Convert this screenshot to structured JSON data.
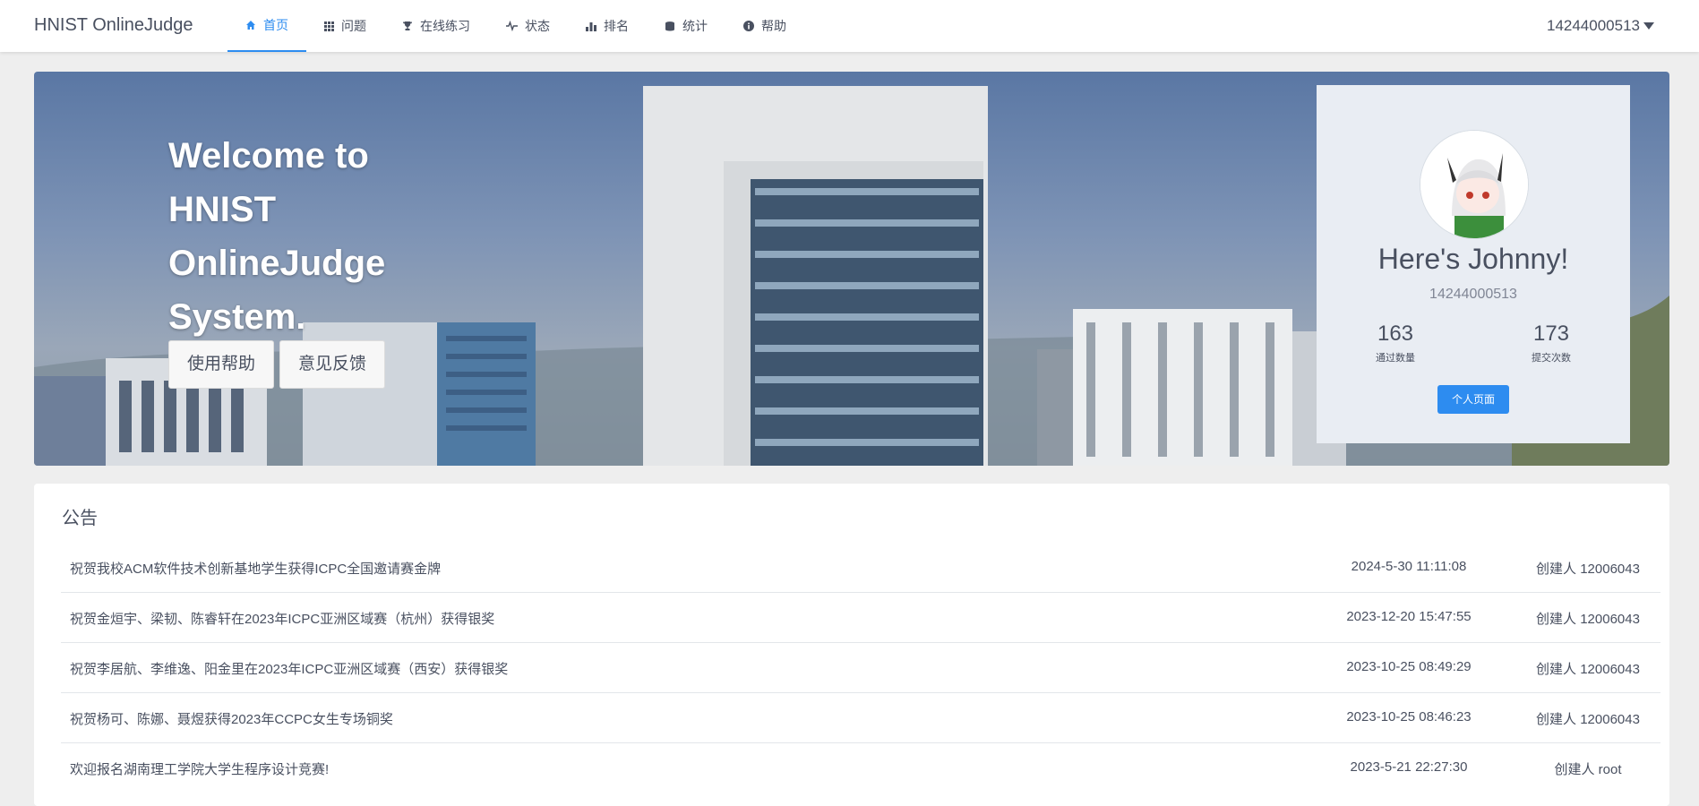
{
  "nav": {
    "brand": "HNIST OnlineJudge",
    "items": [
      {
        "label": "首页",
        "icon": "home-icon"
      },
      {
        "label": "问题",
        "icon": "grid-icon"
      },
      {
        "label": "在线练习",
        "icon": "trophy-icon"
      },
      {
        "label": "状态",
        "icon": "pulse-icon"
      },
      {
        "label": "排名",
        "icon": "bar-chart-icon"
      },
      {
        "label": "统计",
        "icon": "database-icon"
      },
      {
        "label": "帮助",
        "icon": "info-icon"
      }
    ],
    "active": "首页",
    "user": "14244000513",
    "accent": "#2d8cf0"
  },
  "banner": {
    "welcome": "Welcome to HNIST OnlineJudge System.",
    "buttons": [
      "使用帮助",
      "意见反馈"
    ]
  },
  "profile": {
    "greeting": "Here's Johnny!",
    "username": "14244000513",
    "solved": "163",
    "solved_label": "通过数量",
    "submissions": "173",
    "submissions_label": "提交次数",
    "button": "个人页面"
  },
  "announcements": {
    "title": "公告",
    "rows": [
      {
        "title": "祝贺我校ACM软件技术创新基地学生获得ICPC全国邀请赛金牌",
        "date": "2024-5-30 11:11:08",
        "creator": "创建人 12006043"
      },
      {
        "title": "祝贺金烜宇、梁韧、陈睿轩在2023年ICPC亚洲区域赛（杭州）获得银奖",
        "date": "2023-12-20 15:47:55",
        "creator": "创建人 12006043"
      },
      {
        "title": "祝贺李居航、李维逸、阳金里在2023年ICPC亚洲区域赛（西安）获得银奖",
        "date": "2023-10-25 08:49:29",
        "creator": "创建人 12006043"
      },
      {
        "title": "祝贺杨可、陈娜、聂煜获得2023年CCPC女生专场铜奖",
        "date": "2023-10-25 08:46:23",
        "creator": "创建人 12006043"
      },
      {
        "title": "欢迎报名湖南理工学院大学生程序设计竞赛!",
        "date": "2023-5-21 22:27:30",
        "creator": "创建人 root"
      }
    ]
  }
}
